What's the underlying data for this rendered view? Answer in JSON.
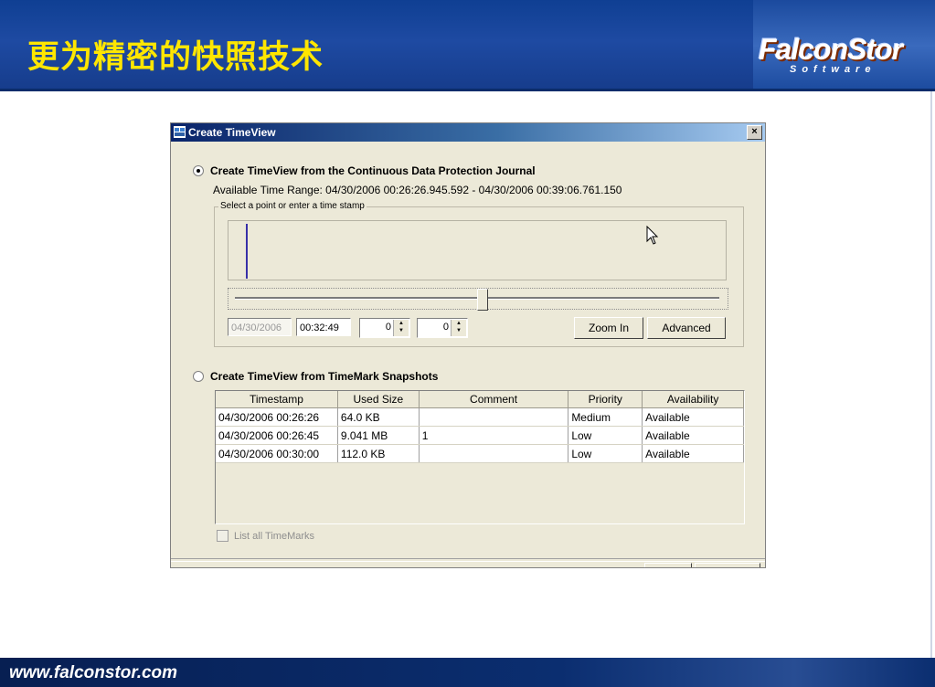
{
  "slide": {
    "title": "更为精密的快照技术",
    "logo_text": "FalconStor",
    "logo_sub": "Software",
    "footer_url": "www.falconstor.com"
  },
  "dialog": {
    "title": "Create TimeView",
    "close_glyph": "×",
    "option_cdp_label": "Create TimeView from the Continuous Data Protection Journal",
    "option_cdp_selected": true,
    "available_range": "Available Time Range:   04/30/2006 00:26:26.945.592  -  04/30/2006 00:39:06.761.150",
    "group_label": "Select a point or enter a time stamp",
    "slider_position": 0.51,
    "date_value": "04/30/2006",
    "time_value": "00:32:49",
    "spin1_value": "0",
    "spin2_value": "0",
    "zoom_in_label": "Zoom In",
    "advanced_label": "Advanced",
    "option_timemark_label": "Create TimeView from TimeMark Snapshots",
    "option_timemark_selected": false,
    "table": {
      "headers": [
        "Timestamp",
        "Used Size",
        "Comment",
        "Priority",
        "Availability"
      ],
      "rows": [
        [
          "04/30/2006 00:26:26",
          "64.0 KB",
          "",
          "Medium",
          "Available"
        ],
        [
          "04/30/2006 00:26:45",
          "9.041 MB",
          "1",
          "Low",
          "Available"
        ],
        [
          "04/30/2006 00:30:00",
          "112.0 KB",
          "",
          "Low",
          "Available"
        ]
      ]
    },
    "list_all_label": "List all TimeMarks",
    "list_all_checked": false
  },
  "colors": {
    "header_blue": "#1e4aa2",
    "title_yellow": "#ffe600",
    "dialog_bg": "#ece9d8"
  }
}
